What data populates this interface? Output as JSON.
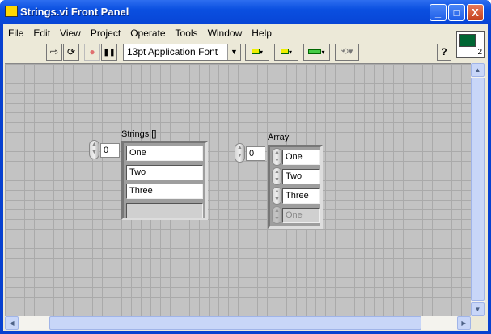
{
  "window": {
    "title": "Strings.vi Front Panel",
    "min": "_",
    "max": "□",
    "close": "X"
  },
  "menu": [
    "File",
    "Edit",
    "View",
    "Project",
    "Operate",
    "Tools",
    "Window",
    "Help"
  ],
  "toolbar": {
    "run": "⇨",
    "run_continuous": "⟳",
    "abort": "●",
    "pause": "❚❚",
    "font": "13pt Application Font",
    "dropdown": "▼",
    "help": "?"
  },
  "connector": {
    "label": "2"
  },
  "strings_array": {
    "label": "Strings []",
    "index": "0",
    "items": [
      "One",
      "Two",
      "Three",
      ""
    ]
  },
  "array": {
    "label": "Array",
    "index": "0",
    "items": [
      "One",
      "Two",
      "Three",
      "One"
    ]
  },
  "scroll": {
    "up": "▲",
    "down": "▼",
    "left": "◀",
    "right": "▶"
  }
}
